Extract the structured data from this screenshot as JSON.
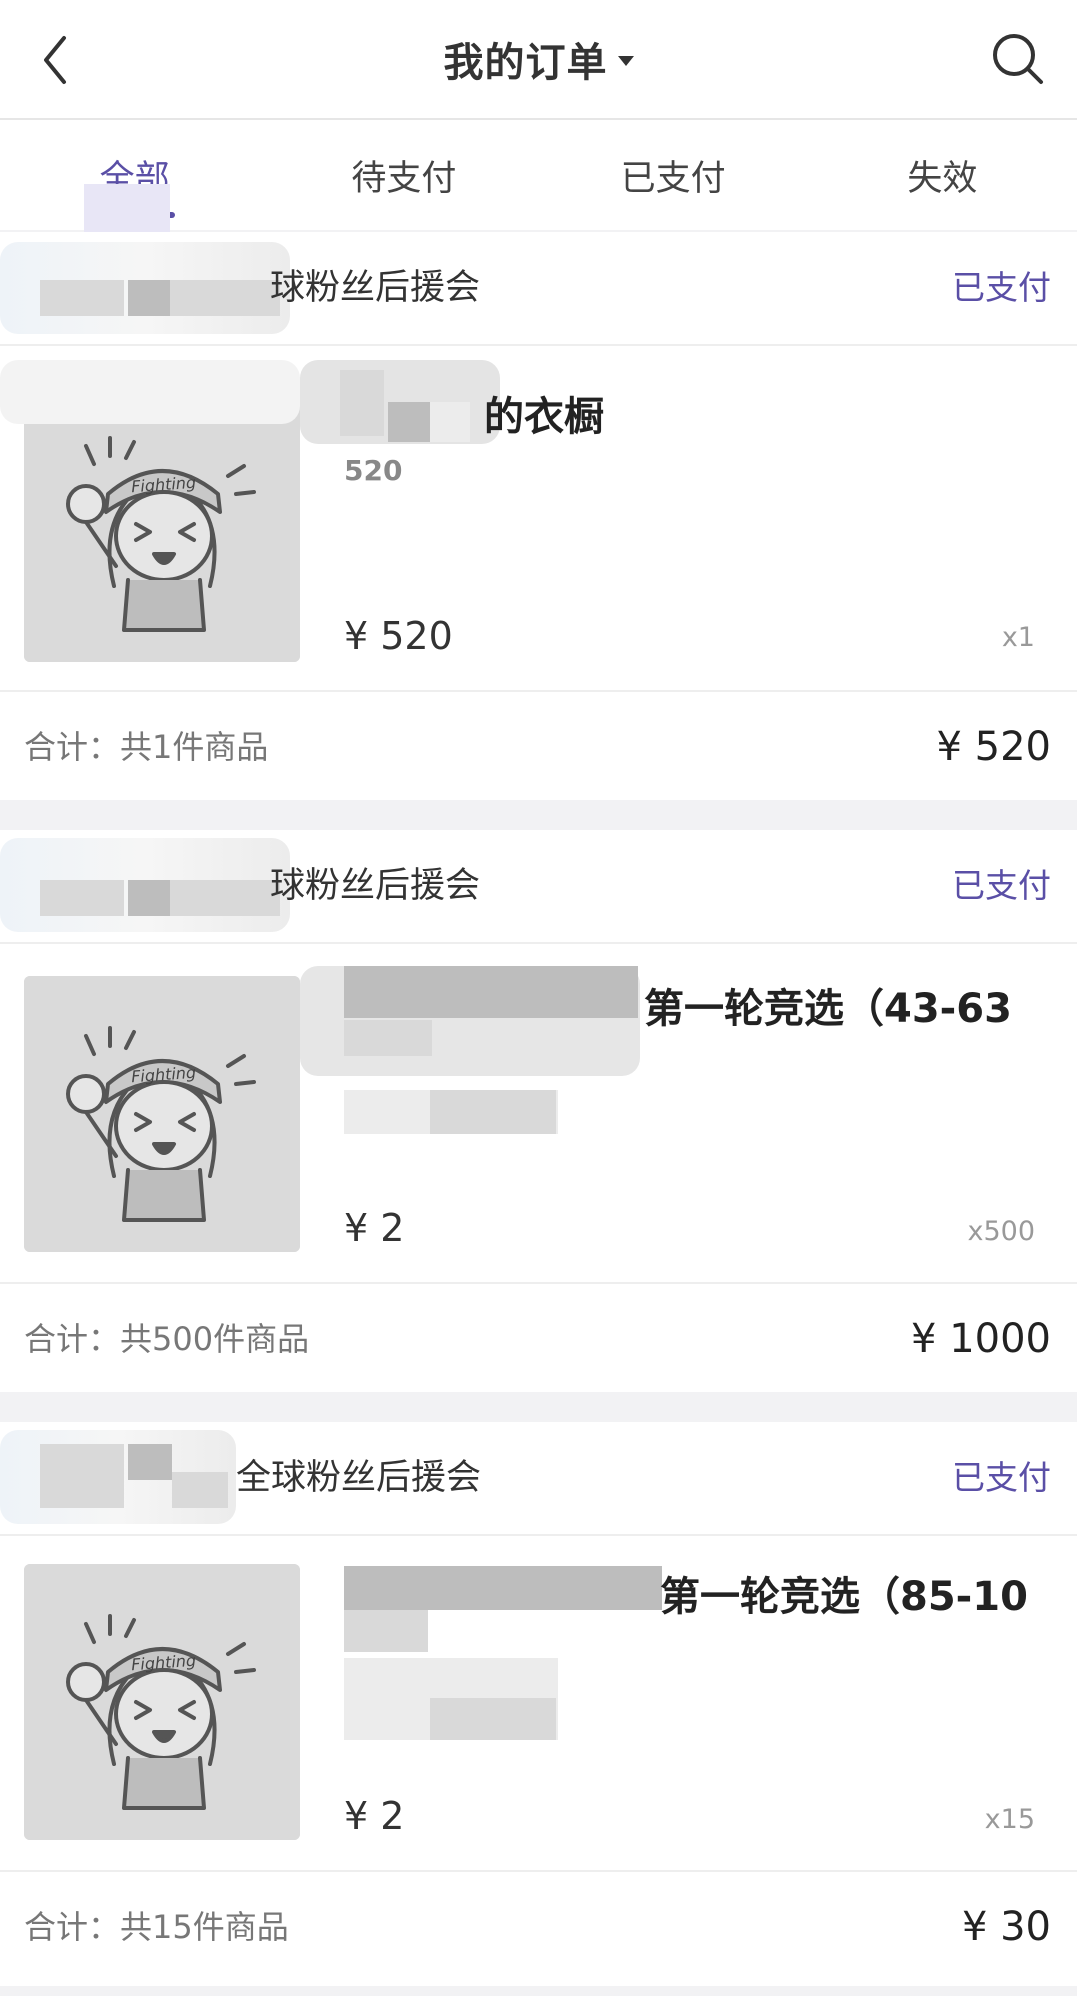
{
  "header": {
    "title": "我的订单"
  },
  "tabs": [
    "全部",
    "待支付",
    "已支付",
    "失效"
  ],
  "orders": [
    {
      "shop": "球粉丝后援会",
      "status": "已支付",
      "item_title": "的衣橱",
      "item_sub": "520",
      "price": "¥ 520",
      "qty": "x1",
      "total_label": "合计：共1件商品",
      "total": "¥  520"
    },
    {
      "shop": "球粉丝后援会",
      "status": "已支付",
      "item_title": "第一轮竞选（43-63",
      "item_sub": "",
      "price": "¥ 2",
      "qty": "x500",
      "total_label": "合计：共500件商品",
      "total": "¥  1000"
    },
    {
      "shop": "全球粉丝后援会",
      "status": "已支付",
      "item_title": "第一轮竞选（85-10",
      "item_sub": "",
      "price": "¥ 2",
      "qty": "x15",
      "total_label": "合计：共15件商品",
      "total": "¥  30"
    }
  ],
  "icons": {
    "back": "chevron-left-icon",
    "search": "search-icon",
    "title_dropdown": "caret-down-icon",
    "thumbnail": "fighting-girl-placeholder"
  },
  "colors": {
    "accent": "#5a4fa6",
    "thumb_bg": "#dadada",
    "page_bg": "#f2f2f4"
  },
  "thumbnail_text": "Fighting"
}
